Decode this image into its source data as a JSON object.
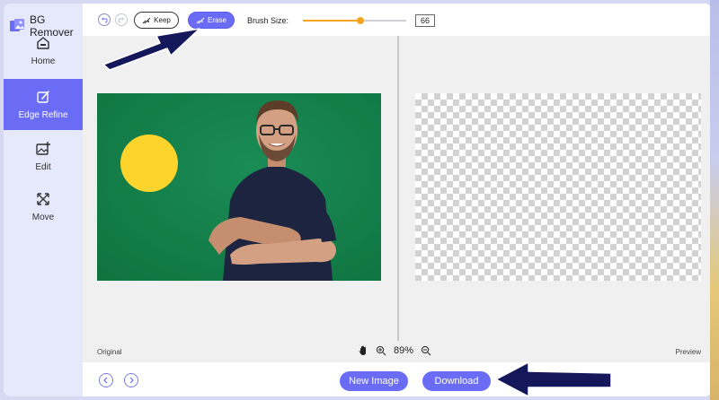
{
  "app": {
    "title": "BG Remover"
  },
  "sidebar": {
    "items": [
      {
        "label": "Home",
        "icon": "home-icon",
        "active": false
      },
      {
        "label": "Edge Refine",
        "icon": "edge-refine-icon",
        "active": true
      },
      {
        "label": "Edit",
        "icon": "edit-image-icon",
        "active": false
      },
      {
        "label": "Move",
        "icon": "move-icon",
        "active": false
      }
    ]
  },
  "toolbar": {
    "keep_label": "Keep",
    "erase_label": "Erase",
    "brush_size_label": "Brush Size:",
    "brush_size_value": "66",
    "brush_slider_fraction": 0.56
  },
  "canvas": {
    "original_label": "Original",
    "preview_label": "Preview",
    "zoom_value": "89%"
  },
  "bottom": {
    "new_image_label": "New Image",
    "download_label": "Download"
  },
  "colors": {
    "accent": "#6a6cf6",
    "slider": "#f4a41e",
    "photo_background": "#15804c",
    "circle": "#fdd42c",
    "arrow": "#14175a"
  }
}
